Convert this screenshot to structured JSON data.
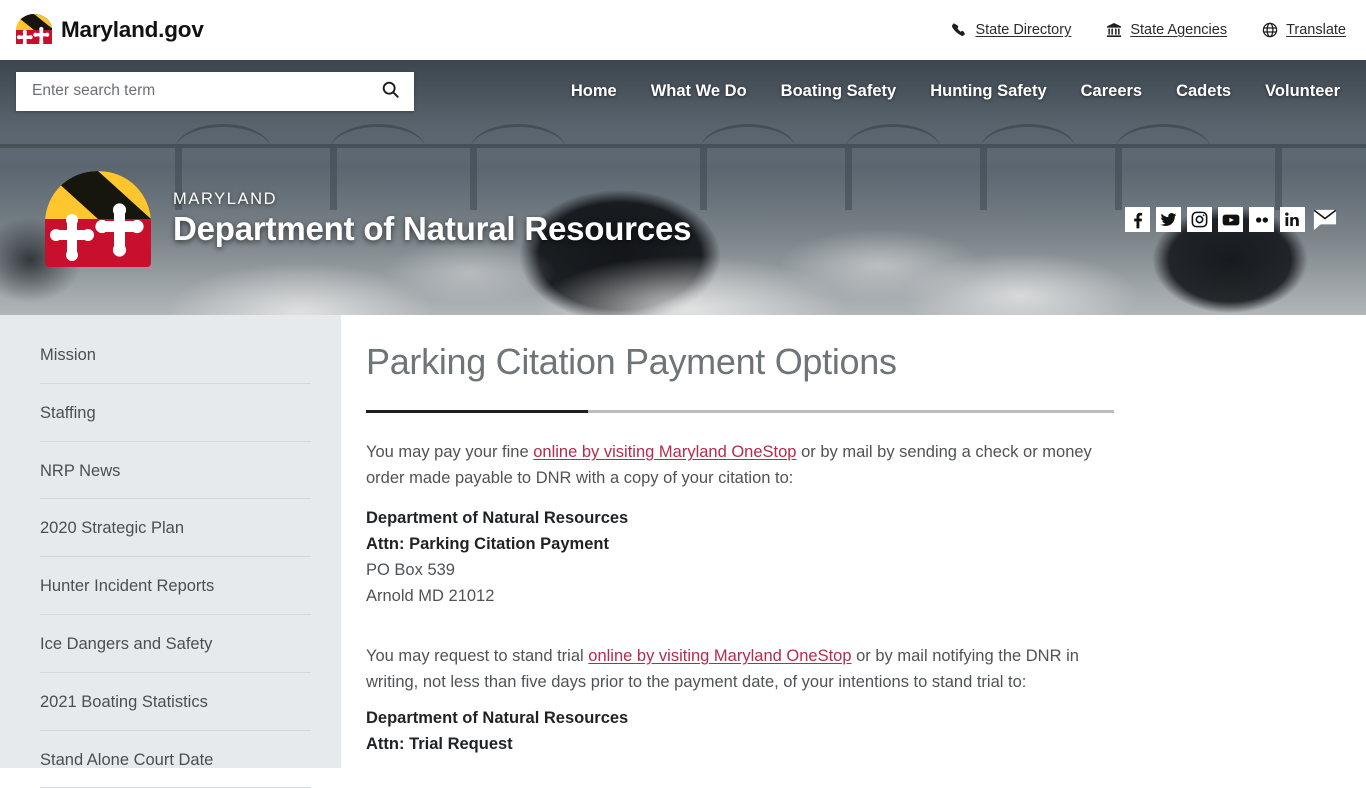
{
  "topbar": {
    "brand_label": "Maryland.gov",
    "brand_icon": "maryland-flag-icon",
    "links": [
      {
        "label": "State Directory",
        "icon": "phone-icon"
      },
      {
        "label": "State Agencies",
        "icon": "bank-icon"
      },
      {
        "label": "Translate",
        "icon": "globe-icon"
      }
    ]
  },
  "search": {
    "placeholder": "Enter search term",
    "value": "",
    "icon": "search-icon"
  },
  "nav": {
    "items": [
      {
        "label": "Home"
      },
      {
        "label": "What We Do"
      },
      {
        "label": "Boating Safety"
      },
      {
        "label": "Hunting Safety"
      },
      {
        "label": "Careers"
      },
      {
        "label": "Cadets"
      },
      {
        "label": "Volunteer"
      }
    ]
  },
  "hero": {
    "seal_icon": "maryland-state-seal-icon",
    "eyebrow": "MARYLAND",
    "title": "Department of Natural Resources",
    "socials": [
      {
        "name": "facebook-icon",
        "label": "Facebook"
      },
      {
        "name": "twitter-icon",
        "label": "Twitter"
      },
      {
        "name": "instagram-icon",
        "label": "Instagram"
      },
      {
        "name": "youtube-icon",
        "label": "YouTube"
      },
      {
        "name": "flickr-icon",
        "label": "Flickr"
      },
      {
        "name": "linkedin-icon",
        "label": "LinkedIn"
      },
      {
        "name": "email-icon",
        "label": "Email"
      }
    ]
  },
  "sidebar": {
    "items": [
      {
        "label": "Mission"
      },
      {
        "label": "Staffing"
      },
      {
        "label": "NRP News"
      },
      {
        "label": "2020 Strategic Plan"
      },
      {
        "label": "Hunter Incident Reports"
      },
      {
        "label": "Ice Dangers and Safety"
      },
      {
        "label": "2021 Boating Statistics"
      },
      {
        "label": "Stand Alone Court Date"
      }
    ]
  },
  "main": {
    "title": "Parking Citation Payment Options",
    "paragraph1": {
      "before": "You may pay your fine ",
      "link": "online by visiting Maryland OneStop",
      "after": " or by mail by sending a check or money order made payable to DNR with a copy of your citation to:"
    },
    "address1": [
      {
        "text": "Department of Natural Resources",
        "bold": true
      },
      {
        "text": "Attn: Parking Citation Payment",
        "bold": true
      },
      {
        "text": "PO Box 539",
        "bold": false
      },
      {
        "text": "Arnold MD 21012",
        "bold": false
      }
    ],
    "paragraph2": {
      "before": "You may request to stand trial ",
      "link": "online by visiting Maryland OneStop",
      "after": " or by mail notifying the DNR in writing, not less than five days prior to the payment date, of your intentions to stand trial to:"
    },
    "address2": [
      {
        "text": "Department of Natural Resources",
        "bold": true
      },
      {
        "text": "Attn: Trial Request",
        "bold": true
      }
    ]
  },
  "colors": {
    "link": "#b32c4a",
    "sidebar_bg": "#e7eaec",
    "title_text": "#6f7478",
    "flag_gold": "#ffc62e",
    "flag_black": "#16160f",
    "flag_red": "#c8102e",
    "flag_white": "#ffffff"
  }
}
